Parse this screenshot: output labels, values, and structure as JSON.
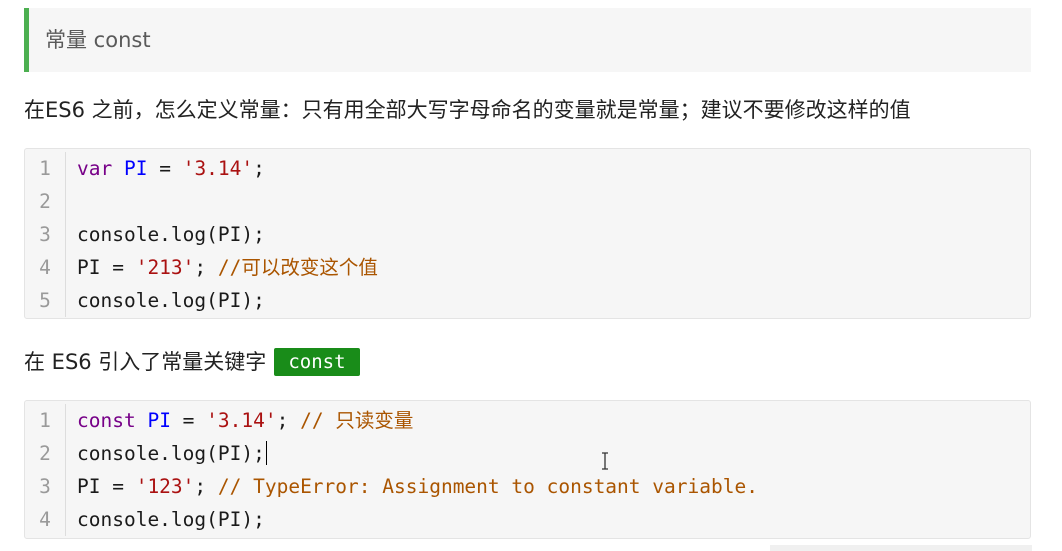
{
  "heading": {
    "title": "常量 const",
    "accent_color": "#4caf50"
  },
  "intro_paragraph": "在ES6 之前，怎么定义常量：只有用全部大写字母命名的变量就是常量；建议不要修改这样的值",
  "code_block_1": {
    "lines": [
      {
        "number": "1",
        "tokens": [
          {
            "text": "var",
            "type": "kw"
          },
          {
            "text": " ",
            "type": "plain"
          },
          {
            "text": "PI",
            "type": "def"
          },
          {
            "text": " = ",
            "type": "plain"
          },
          {
            "text": "'3.14'",
            "type": "str"
          },
          {
            "text": ";",
            "type": "plain"
          }
        ]
      },
      {
        "number": "2",
        "tokens": []
      },
      {
        "number": "3",
        "tokens": [
          {
            "text": "console.log(PI);",
            "type": "plain"
          }
        ]
      },
      {
        "number": "4",
        "tokens": [
          {
            "text": "PI = ",
            "type": "plain"
          },
          {
            "text": "'213'",
            "type": "str"
          },
          {
            "text": "; ",
            "type": "plain"
          },
          {
            "text": "//可以改变这个值",
            "type": "cm"
          }
        ]
      },
      {
        "number": "5",
        "tokens": [
          {
            "text": "console.log(PI);",
            "type": "plain"
          }
        ]
      }
    ]
  },
  "es6_paragraph": {
    "text": "在 ES6 引入了常量关键字",
    "keyword": "const",
    "keyword_bg": "#198c19"
  },
  "code_block_2": {
    "lines": [
      {
        "number": "1",
        "tokens": [
          {
            "text": "const",
            "type": "kw"
          },
          {
            "text": " ",
            "type": "plain"
          },
          {
            "text": "PI",
            "type": "def"
          },
          {
            "text": " = ",
            "type": "plain"
          },
          {
            "text": "'3.14'",
            "type": "str"
          },
          {
            "text": "; ",
            "type": "plain"
          },
          {
            "text": "// 只读变量",
            "type": "cm"
          }
        ]
      },
      {
        "number": "2",
        "tokens": [
          {
            "text": "console.log(PI);",
            "type": "plain"
          }
        ],
        "caret": true
      },
      {
        "number": "3",
        "tokens": [
          {
            "text": "PI = ",
            "type": "plain"
          },
          {
            "text": "'123'",
            "type": "str"
          },
          {
            "text": "; ",
            "type": "plain"
          },
          {
            "text": "// TypeError: Assignment to constant variable.",
            "type": "cm"
          }
        ]
      },
      {
        "number": "4",
        "tokens": [
          {
            "text": "console.log(PI);",
            "type": "plain"
          }
        ]
      }
    ]
  },
  "syntax_colors": {
    "kw": "#770088",
    "def": "#0000ff",
    "str": "#aa1111",
    "cm": "#aa5500",
    "plain": "#1a1a1a"
  },
  "icons": {
    "cursor": "text-cursor-icon"
  }
}
